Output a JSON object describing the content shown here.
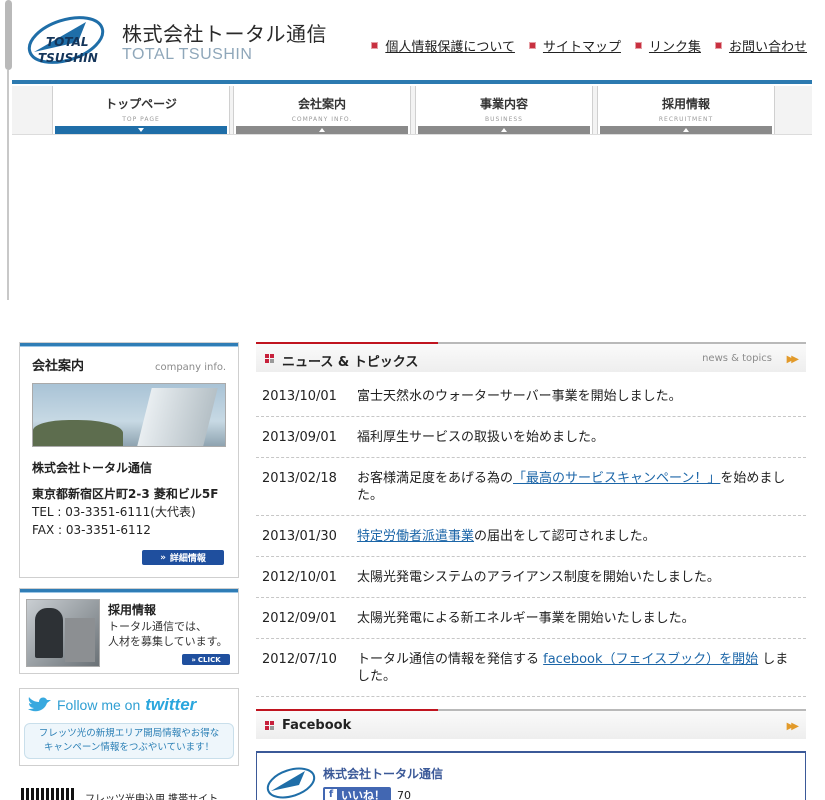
{
  "header": {
    "brand_jp": "株式会社トータル通信",
    "brand_en": "TOTAL TSUSHIN",
    "logo_top": "TOTAL",
    "logo_bottom": "TSUSHIN",
    "links": [
      {
        "label": "個人情報保護について"
      },
      {
        "label": "サイトマップ"
      },
      {
        "label": "リンク集"
      },
      {
        "label": "お問い合わせ"
      }
    ]
  },
  "nav": {
    "items": [
      {
        "label": "トップページ",
        "sub": "TOP PAGE"
      },
      {
        "label": "会社案内",
        "sub": "COMPANY INFO."
      },
      {
        "label": "事業内容",
        "sub": "BUSINESS"
      },
      {
        "label": "採用情報",
        "sub": "RECRUITMENT"
      }
    ]
  },
  "company": {
    "heading": "会社案内",
    "heading_en": "company info.",
    "name": "株式会社トータル通信",
    "address": "東京都新宿区片町2-3 菱和ビル5F",
    "tel": "TEL : 03-3351-6111(大代表)",
    "fax": "FAX : 03-3351-6112",
    "detail_button": "詳細情報"
  },
  "recruit": {
    "title": "採用情報",
    "line1": "トータル通信では、",
    "line2": "人材を募集しています。",
    "button": "CLICK"
  },
  "twitter": {
    "follow": "Follow me on",
    "word": "twitter",
    "line1": "フレッツ光の新規エリア開局情報やお得な",
    "line2": "キャンペーン情報をつぶやいています！"
  },
  "mobile": {
    "text": "フレッツ光申込用 携帯サイト"
  },
  "news": {
    "title": "ニュース & トピックス",
    "title_en": "news & topics",
    "items": [
      {
        "date": "2013/10/01",
        "pre": "富士天然水のウォーターサーバー事業を開始しました。",
        "link": "",
        "post": ""
      },
      {
        "date": "2013/09/01",
        "pre": "福利厚生サービスの取扱いを始めました。",
        "link": "",
        "post": ""
      },
      {
        "date": "2013/02/18",
        "pre": "お客様満足度をあげる為の",
        "link": "「最高のサービスキャンペーン！」",
        "post": "を始めました。"
      },
      {
        "date": "2013/01/30",
        "pre": "",
        "link": "特定労働者派遣事業",
        "post": "の届出をして認可されました。"
      },
      {
        "date": "2012/10/01",
        "pre": "太陽光発電システムのアライアンス制度を開始いたしました。",
        "link": "",
        "post": ""
      },
      {
        "date": "2012/09/01",
        "pre": "太陽光発電による新エネルギー事業を開始いたしました。",
        "link": "",
        "post": ""
      },
      {
        "date": "2012/07/10",
        "pre": "トータル通信の情報を発信する ",
        "link": "facebook（フェイスブック）を開始",
        "post": " しました。"
      }
    ]
  },
  "facebook": {
    "title": "Facebook",
    "page_name": "株式会社トータル通信",
    "like": "いいね！",
    "count": "70"
  },
  "colors": {
    "accent_blue": "#2c7ab0",
    "accent_red": "#c0141f",
    "link": "#1c66a8"
  }
}
